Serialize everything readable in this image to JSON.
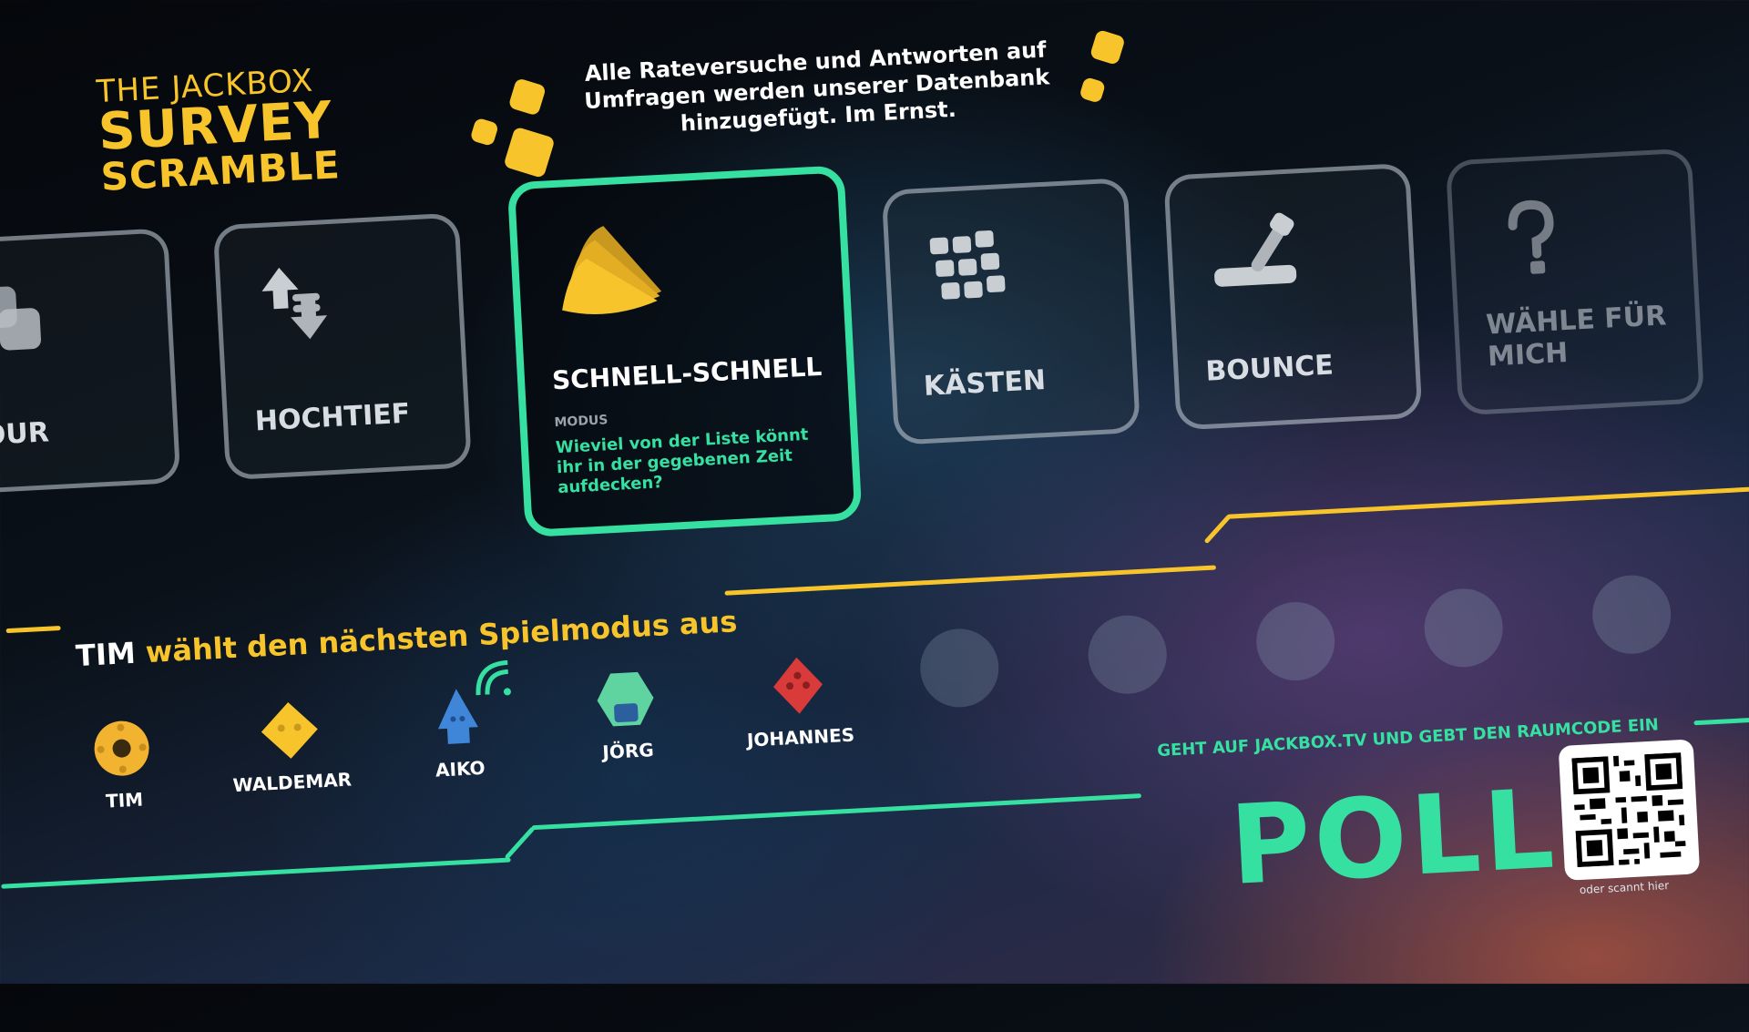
{
  "logo": {
    "line1": "THE JACKBOX",
    "line2": "SURVEY",
    "line3": "SCRAMBLE"
  },
  "notice": "Alle Rateversuche und Antworten auf Umfragen werden unserer Datenbank hinzugefügt. Im Ernst.",
  "modes": [
    {
      "label": "TOUR",
      "icon": "overlapping-squares-icon"
    },
    {
      "label": "HOCHTIEF",
      "icon": "up-down-arrows-icon"
    },
    {
      "label": "SCHNELL-SCHNELL",
      "icon": "fan-cards-icon",
      "mode_label": "MODUS",
      "description": "Wieviel von der Liste könnt ihr in der gegebenen Zeit aufdecken?"
    },
    {
      "label": "KÄSTEN",
      "icon": "grid-boxes-icon"
    },
    {
      "label": "BOUNCE",
      "icon": "lever-icon"
    },
    {
      "label": "WÄHLE FÜR MICH",
      "icon": "question-mark-icon"
    }
  ],
  "chooser": {
    "name": "TIM",
    "text": "wählt den nächsten Spielmodus aus"
  },
  "players": [
    {
      "name": "TIM",
      "color": "#f2b430"
    },
    {
      "name": "WALDEMAR",
      "color": "#f7c52b"
    },
    {
      "name": "AIKO",
      "color": "#3f86d9"
    },
    {
      "name": "JÖRG",
      "color": "#5fd3a0"
    },
    {
      "name": "JOHANNES",
      "color": "#d93a3a"
    }
  ],
  "instruction": "GEHT AUF JACKBOX.TV UND GEBT DEN RAUMCODE EIN",
  "room_code": "POLL",
  "qr_label": "oder scannt hier",
  "colors": {
    "accent_yellow": "#f7c52b",
    "accent_green": "#35e0a1"
  }
}
